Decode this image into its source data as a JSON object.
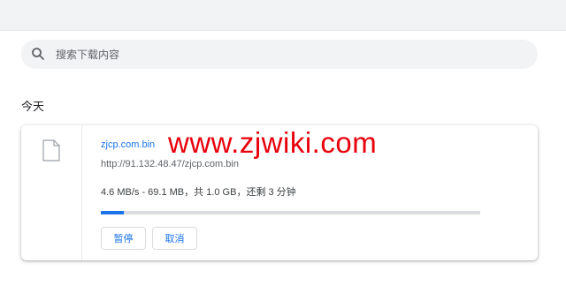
{
  "search": {
    "placeholder": "搜索下载内容"
  },
  "section": {
    "title": "今天"
  },
  "download": {
    "filename": "zjcp.com.bin",
    "url": "http://91.132.48.47/zjcp.com.bin",
    "status": "4.6 MB/s - 69.1 MB，共 1.0 GB，还剩 3 分钟",
    "progress": 0.06,
    "pause_label": "暂停",
    "cancel_label": "取消"
  },
  "watermark": {
    "text": "www.zjwiki.com"
  },
  "colors": {
    "accent": "#1a73e8",
    "watermark": "#e8000b"
  }
}
